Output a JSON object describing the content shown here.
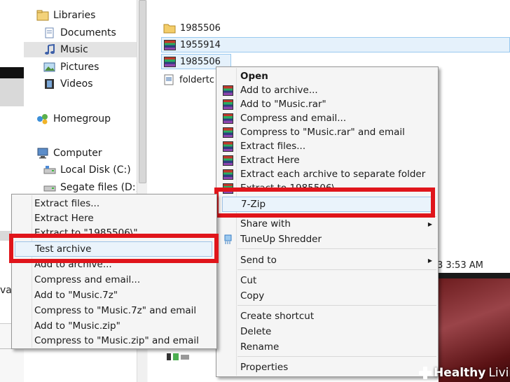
{
  "nav": {
    "items": [
      {
        "label": "Libraries",
        "icon": "libraries-icon"
      },
      {
        "label": "Documents",
        "icon": "documents-icon"
      },
      {
        "label": "Music",
        "icon": "music-icon"
      },
      {
        "label": "Pictures",
        "icon": "pictures-icon"
      },
      {
        "label": "Videos",
        "icon": "videos-icon"
      },
      {
        "label": "Homegroup",
        "icon": "homegroup-icon"
      },
      {
        "label": "Computer",
        "icon": "computer-icon"
      },
      {
        "label": "Local Disk (C:)",
        "icon": "drive-icon"
      },
      {
        "label": "Segate files (D:)",
        "icon": "drive-icon"
      }
    ]
  },
  "files": {
    "rows": [
      {
        "name": "1985506",
        "type": "folder"
      },
      {
        "name": "1955914",
        "type": "archive"
      },
      {
        "name": "1985506",
        "type": "archive"
      },
      {
        "name": "foldertc",
        "type": "file"
      }
    ],
    "date_fragment": "3 3:53 AM",
    "left_fragment": "val"
  },
  "main_menu": {
    "items": [
      {
        "label": "Open",
        "bold": true
      },
      {
        "label": "Add to archive..."
      },
      {
        "label": "Add to \"Music.rar\""
      },
      {
        "label": "Compress and email..."
      },
      {
        "label": "Compress to \"Music.rar\" and email"
      },
      {
        "label": "Extract files..."
      },
      {
        "label": "Extract Here"
      },
      {
        "label": "Extract each archive to separate folder"
      },
      {
        "label": "Extract to 1985506\\"
      },
      {
        "label": "7-Zip"
      },
      {
        "label": "Share with"
      },
      {
        "label": "TuneUp Shredder"
      },
      {
        "label": "Send to"
      },
      {
        "label": "Cut"
      },
      {
        "label": "Copy"
      },
      {
        "label": "Create shortcut"
      },
      {
        "label": "Delete"
      },
      {
        "label": "Rename"
      },
      {
        "label": "Properties"
      }
    ]
  },
  "sub_menu": {
    "items": [
      {
        "label": "Extract files..."
      },
      {
        "label": "Extract Here"
      },
      {
        "label": "Extract to \"1985506\\\""
      },
      {
        "label": "Test archive"
      },
      {
        "label": "Add to archive..."
      },
      {
        "label": "Compress and email..."
      },
      {
        "label": "Add to \"Music.7z\""
      },
      {
        "label": "Compress to \"Music.7z\" and email"
      },
      {
        "label": "Add to \"Music.zip\""
      },
      {
        "label": "Compress to \"Music.zip\" and email"
      }
    ]
  },
  "colors": {
    "highlight_red": "#e0151b",
    "selection_blue": "#e5f1fb"
  },
  "watermark": {
    "brand_bold": "Healthy",
    "brand_light": "Living"
  }
}
